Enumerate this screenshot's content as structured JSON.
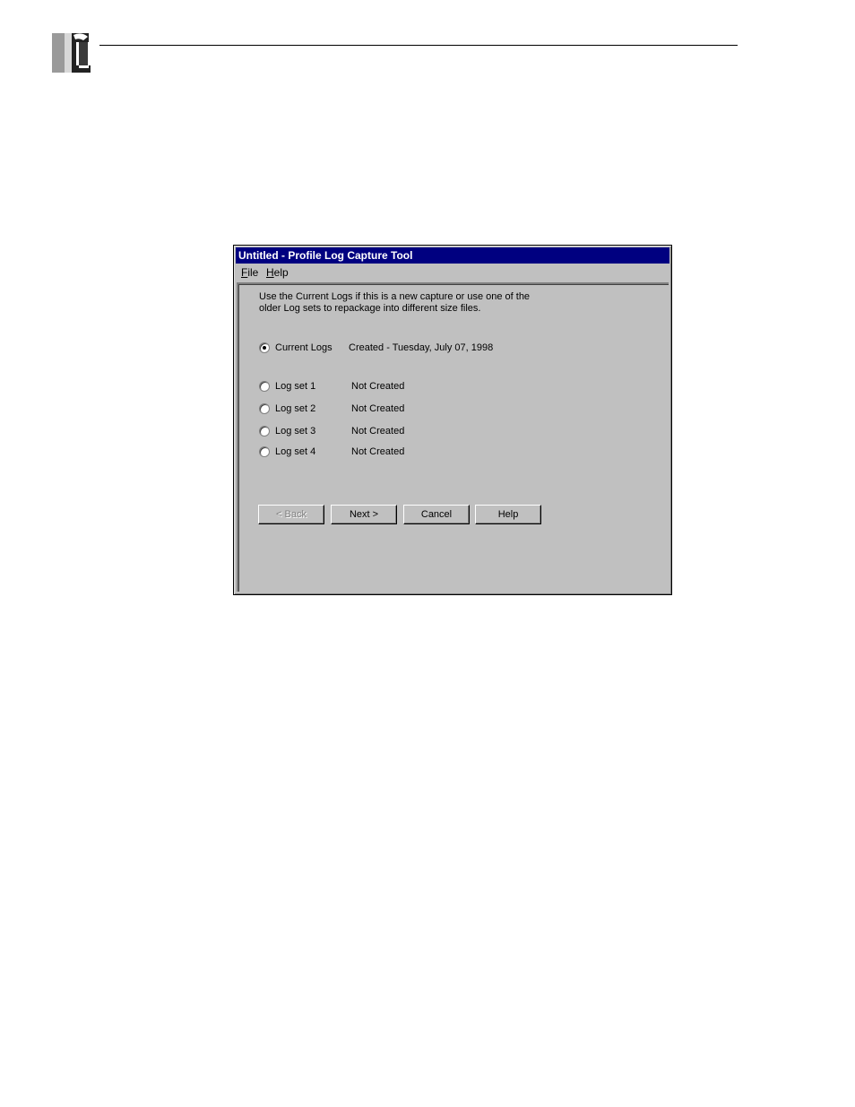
{
  "window": {
    "title": "Untitled - Profile Log Capture Tool"
  },
  "menu": {
    "file": {
      "accel": "F",
      "rest": "ile"
    },
    "help": {
      "accel": "H",
      "rest": "elp"
    }
  },
  "description": {
    "line1": "Use the Current Logs if this is a new capture or use one of the",
    "line2": "older Log sets to repackage into different size files."
  },
  "options": [
    {
      "label": "Current Logs",
      "status": "Created - Tuesday, July 07, 1998",
      "selected": true
    },
    {
      "label": "Log set 1",
      "status": "Not Created",
      "selected": false
    },
    {
      "label": "Log set 2",
      "status": "Not Created",
      "selected": false
    },
    {
      "label": "Log set 3",
      "status": "Not Created",
      "selected": false
    },
    {
      "label": "Log set 4",
      "status": "Not Created",
      "selected": false
    }
  ],
  "buttons": {
    "back": "< Back",
    "next": "Next >",
    "cancel": "Cancel",
    "help": "Help"
  }
}
